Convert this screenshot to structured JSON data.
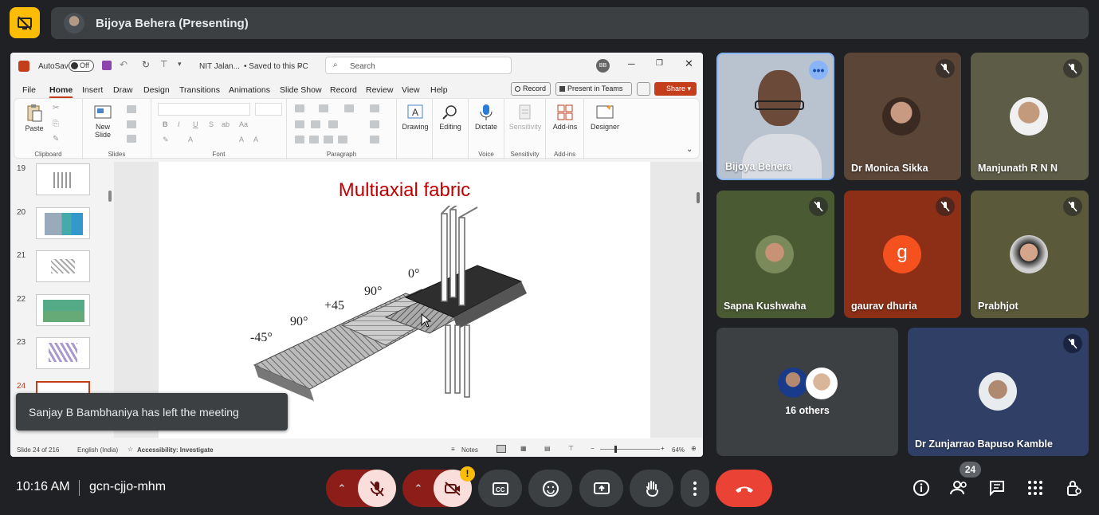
{
  "presenting_banner": {
    "name": "Bijoya Behera (Presenting)"
  },
  "powerpoint": {
    "autosave_label": "AutoSave",
    "autosave_state": "Off",
    "file_name": "NIT Jalan...",
    "save_state": "• Saved to this PC",
    "search_placeholder": "Search",
    "user_initials": "BB",
    "menu": [
      "File",
      "Home",
      "Insert",
      "Draw",
      "Design",
      "Transitions",
      "Animations",
      "Slide Show",
      "Record",
      "Review",
      "View",
      "Help"
    ],
    "record_button": "Record",
    "present_button": "Present in Teams",
    "share_button": "Share",
    "ribbon": {
      "paste": "Paste",
      "clipboard": "Clipboard",
      "new_slide": "New Slide",
      "slides": "Slides",
      "font": "Font",
      "paragraph": "Paragraph",
      "drawing": "Drawing",
      "editing": "Editing",
      "dictate": "Dictate",
      "voice": "Voice",
      "sensitivity": "Sensitivity",
      "sensitivity_group": "Sensitivity",
      "addins": "Add-ins",
      "addins_group": "Add-ins",
      "designer": "Designer"
    },
    "thumbnails": [
      "19",
      "20",
      "21",
      "22",
      "23",
      "24"
    ],
    "slide": {
      "title": "Multiaxial fabric",
      "angles": [
        "-45°",
        "90°",
        "+45",
        "90°",
        "0°"
      ]
    },
    "status": {
      "slide_pos": "Slide 24 of 216",
      "language": "English (India)",
      "accessibility": "Accessibility: Investigate",
      "notes": "Notes",
      "zoom": "64%"
    }
  },
  "toast": "Sanjay B Bambhaniya has left the meeting",
  "participants": [
    {
      "name": "Bijoya Behera",
      "bg": "#b9c3cf"
    },
    {
      "name": "Dr Monica Sikka",
      "bg": "#5b4536"
    },
    {
      "name": "Manjunath R N N",
      "bg": "#5c5c47"
    },
    {
      "name": "Sapna Kushwaha",
      "bg": "#4a5a33"
    },
    {
      "name": "gaurav dhuria",
      "bg": "#8c2f16",
      "initial": "g"
    },
    {
      "name": "Prabhjot",
      "bg": "#5a5a3a"
    },
    {
      "name": "16 others",
      "bg": "#3c4043"
    },
    {
      "name": "Dr Zunjarrao Bapuso Kamble",
      "bg": "#2f3f66"
    }
  ],
  "bottom": {
    "time": "10:16 AM",
    "meeting_code": "gcn-cjjo-mhm",
    "people_count": "24"
  },
  "colors": {
    "end_call": "#ea4335",
    "muted_bg": "#f9dedc",
    "muted_dark": "#8c1d18",
    "present_icon": "#fbbc04"
  }
}
